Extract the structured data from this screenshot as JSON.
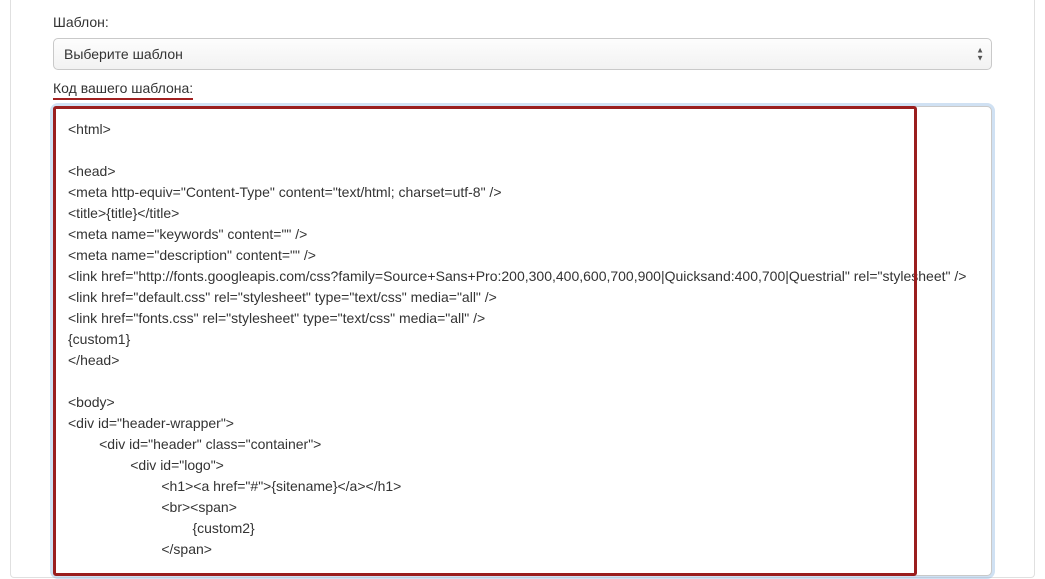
{
  "form": {
    "template_label": "Шаблон:",
    "template_select_value": "Выберите шаблон",
    "code_label": "Код вашего шаблона:",
    "code_value": "<html>\n\n<head>\n<meta http-equiv=\"Content-Type\" content=\"text/html; charset=utf-8\" />\n<title>{title}</title>\n<meta name=\"keywords\" content=\"\" />\n<meta name=\"description\" content=\"\" />\n<link href=\"http://fonts.googleapis.com/css?family=Source+Sans+Pro:200,300,400,600,700,900|Quicksand:400,700|Questrial\" rel=\"stylesheet\" />\n<link href=\"default.css\" rel=\"stylesheet\" type=\"text/css\" media=\"all\" />\n<link href=\"fonts.css\" rel=\"stylesheet\" type=\"text/css\" media=\"all\" />\n{custom1}\n</head>\n\n<body>\n<div id=\"header-wrapper\">\n        <div id=\"header\" class=\"container\">\n                <div id=\"logo\">\n                        <h1><a href=\"#\">{sitename}</a></h1>\n                        <br><span>\n                                {custom2}\n                        </span>"
  }
}
